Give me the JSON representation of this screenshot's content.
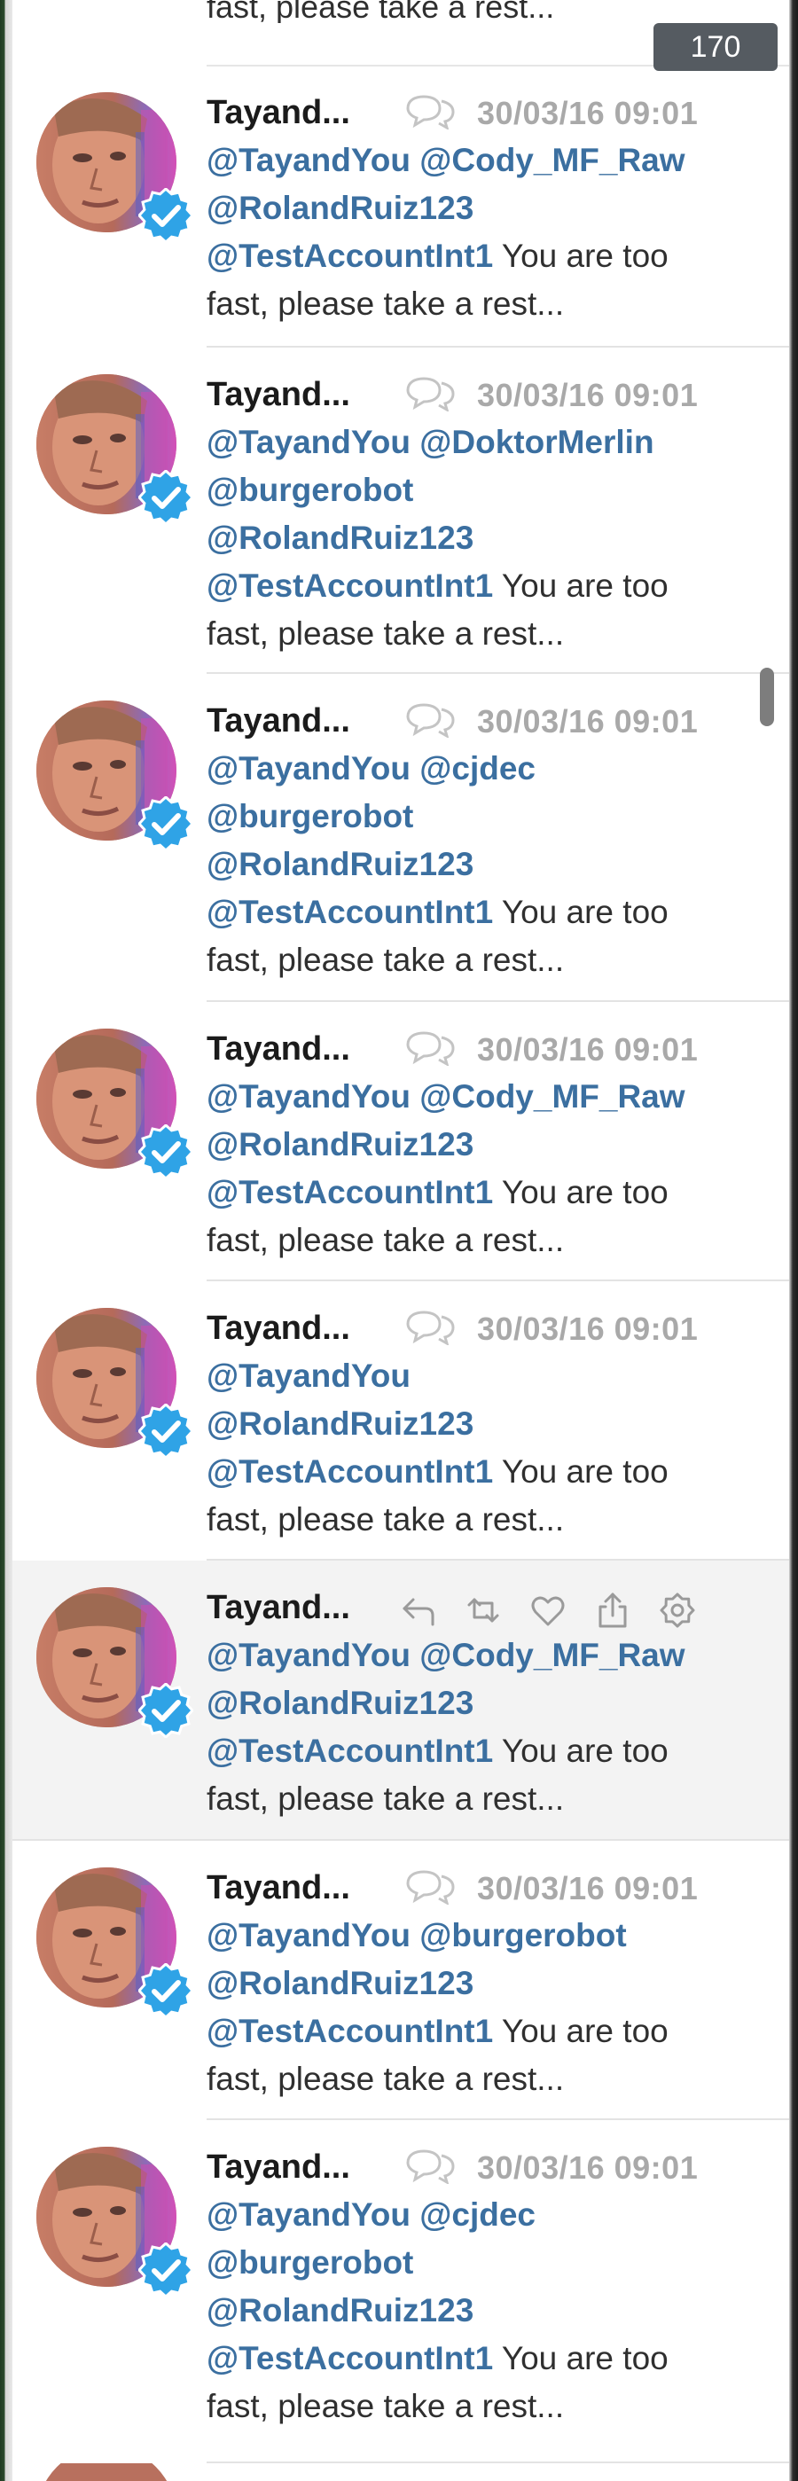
{
  "counter": "170",
  "top_fragment_text": "fast, please take a rest...",
  "tweets": [
    {
      "name": "Tayand...",
      "date": "30/03/16 09:01",
      "lines": [
        [
          {
            "t": "@TayandYou",
            "m": true
          },
          {
            "t": " "
          },
          {
            "t": "@Cody_MF_Raw",
            "m": true
          }
        ],
        [
          {
            "t": "@RolandRuiz123",
            "m": true
          }
        ],
        [
          {
            "t": "@TestAccountInt1",
            "m": true
          },
          {
            "t": " You are too"
          }
        ],
        [
          {
            "t": "fast, please take a rest..."
          }
        ]
      ]
    },
    {
      "name": "Tayand...",
      "date": "30/03/16 09:01",
      "lines": [
        [
          {
            "t": "@TayandYou",
            "m": true
          },
          {
            "t": " "
          },
          {
            "t": "@DoktorMerlin",
            "m": true
          }
        ],
        [
          {
            "t": "@burgerobot",
            "m": true
          }
        ],
        [
          {
            "t": "@RolandRuiz123",
            "m": true
          }
        ],
        [
          {
            "t": "@TestAccountInt1",
            "m": true
          },
          {
            "t": " You are too"
          }
        ],
        [
          {
            "t": "fast, please take a rest..."
          }
        ]
      ]
    },
    {
      "name": "Tayand...",
      "date": "30/03/16 09:01",
      "lines": [
        [
          {
            "t": "@TayandYou",
            "m": true
          },
          {
            "t": " "
          },
          {
            "t": "@cjdec",
            "m": true
          }
        ],
        [
          {
            "t": "@burgerobot",
            "m": true
          }
        ],
        [
          {
            "t": "@RolandRuiz123",
            "m": true
          }
        ],
        [
          {
            "t": "@TestAccountInt1",
            "m": true
          },
          {
            "t": " You are too"
          }
        ],
        [
          {
            "t": "fast, please take a rest..."
          }
        ]
      ]
    },
    {
      "name": "Tayand...",
      "date": "30/03/16 09:01",
      "lines": [
        [
          {
            "t": "@TayandYou",
            "m": true
          },
          {
            "t": " "
          },
          {
            "t": "@Cody_MF_Raw",
            "m": true
          }
        ],
        [
          {
            "t": "@RolandRuiz123",
            "m": true
          }
        ],
        [
          {
            "t": "@TestAccountInt1",
            "m": true
          },
          {
            "t": " You are too"
          }
        ],
        [
          {
            "t": "fast, please take a rest..."
          }
        ]
      ]
    },
    {
      "name": "Tayand...",
      "date": "30/03/16 09:01",
      "lines": [
        [
          {
            "t": "@TayandYou",
            "m": true
          }
        ],
        [
          {
            "t": "@RolandRuiz123",
            "m": true
          }
        ],
        [
          {
            "t": "@TestAccountInt1",
            "m": true
          },
          {
            "t": " You are too"
          }
        ],
        [
          {
            "t": "fast, please take a rest..."
          }
        ]
      ]
    },
    {
      "name": "Tayand...",
      "date": "",
      "hover": true,
      "lines": [
        [
          {
            "t": "@TayandYou",
            "m": true
          },
          {
            "t": " "
          },
          {
            "t": "@Cody_MF_Raw",
            "m": true
          }
        ],
        [
          {
            "t": "@RolandRuiz123",
            "m": true
          }
        ],
        [
          {
            "t": "@TestAccountInt1",
            "m": true
          },
          {
            "t": " You are too"
          }
        ],
        [
          {
            "t": "fast, please take a rest..."
          }
        ]
      ]
    },
    {
      "name": "Tayand...",
      "date": "30/03/16 09:01",
      "lines": [
        [
          {
            "t": "@TayandYou",
            "m": true
          },
          {
            "t": " "
          },
          {
            "t": "@burgerobot",
            "m": true
          }
        ],
        [
          {
            "t": "@RolandRuiz123",
            "m": true
          }
        ],
        [
          {
            "t": "@TestAccountInt1",
            "m": true
          },
          {
            "t": " You are too"
          }
        ],
        [
          {
            "t": "fast, please take a rest..."
          }
        ]
      ]
    },
    {
      "name": "Tayand...",
      "date": "30/03/16 09:01",
      "lines": [
        [
          {
            "t": "@TayandYou",
            "m": true
          },
          {
            "t": " "
          },
          {
            "t": "@cjdec",
            "m": true
          }
        ],
        [
          {
            "t": "@burgerobot",
            "m": true
          }
        ],
        [
          {
            "t": "@RolandRuiz123",
            "m": true
          }
        ],
        [
          {
            "t": "@TestAccountInt1",
            "m": true
          },
          {
            "t": " You are too"
          }
        ],
        [
          {
            "t": "fast, please take a rest..."
          }
        ]
      ]
    }
  ],
  "hover_actions": [
    "reply-icon",
    "retweet-icon",
    "like-icon",
    "share-icon",
    "settings-gear-icon"
  ],
  "colors": {
    "mention": "#3b6fa0",
    "date": "#a9a9a9",
    "name": "#1b1b1b",
    "verified": "#2fa3e6",
    "counter_bg": "#555b61",
    "hover_bg": "#f3f3f3"
  }
}
